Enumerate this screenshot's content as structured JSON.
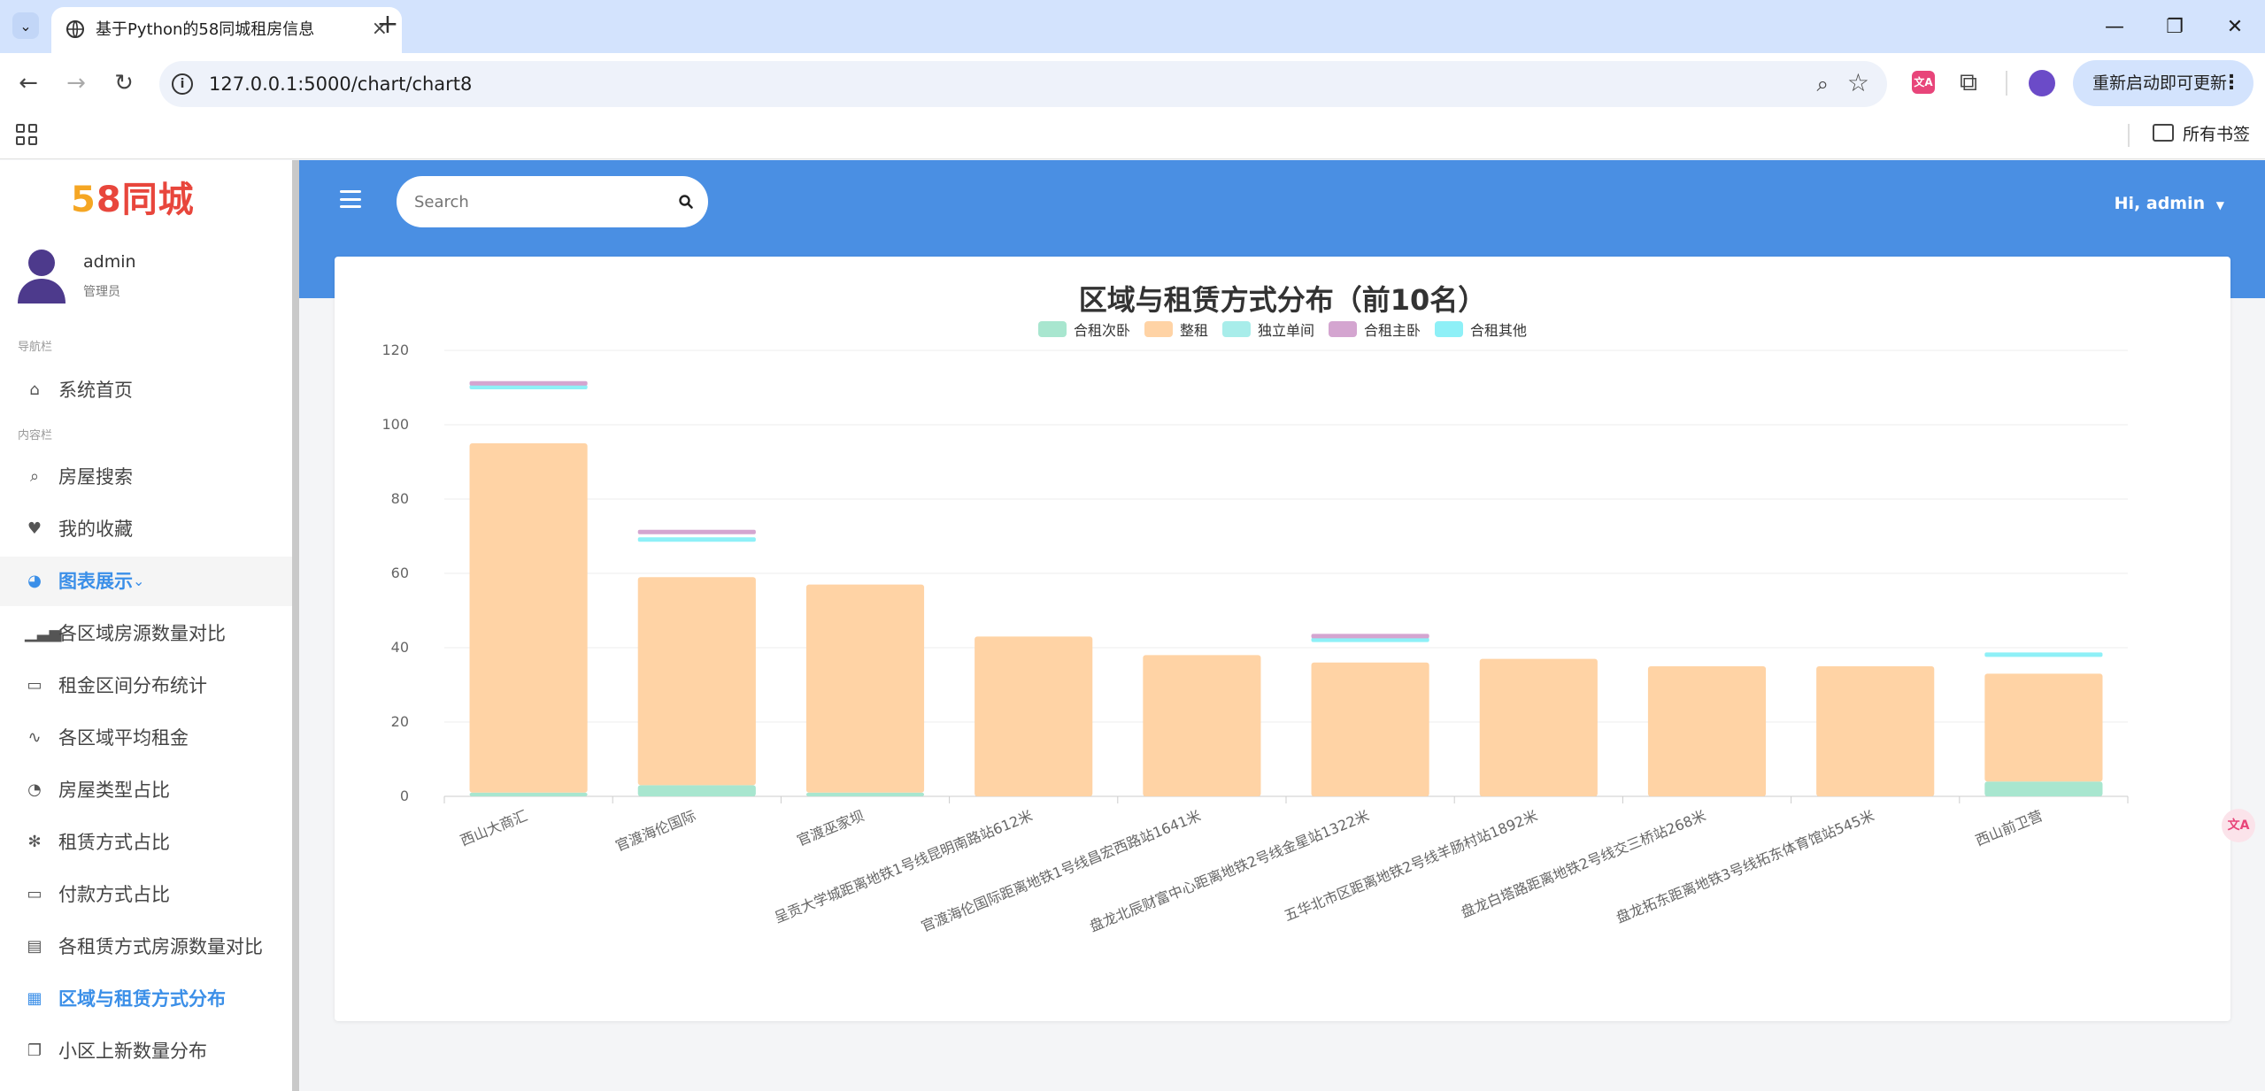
{
  "browser": {
    "tab_title": "基于Python的58同城租房信息",
    "url": "127.0.0.1:5000/chart/chart8",
    "update_button": "重新启动即可更新",
    "bookmarks_label": "所有书签"
  },
  "sidebar": {
    "logo_5": "5",
    "logo_8": "8",
    "logo_text": "同城",
    "user_name": "admin",
    "user_role": "管理员",
    "section_nav": "导航栏",
    "section_content": "内容栏",
    "items": [
      {
        "label": "系统首页",
        "icon": "home-icon"
      },
      {
        "label": "房屋搜索",
        "icon": "search-icon"
      },
      {
        "label": "我的收藏",
        "icon": "heart-icon"
      },
      {
        "label": "图表展示",
        "icon": "pie-chart-icon"
      },
      {
        "label": "各区域房源数量对比",
        "icon": "bar-signal-icon"
      },
      {
        "label": "租金区间分布统计",
        "icon": "keyboard-icon"
      },
      {
        "label": "各区域平均租金",
        "icon": "pulse-icon"
      },
      {
        "label": "房屋类型占比",
        "icon": "gauge-icon"
      },
      {
        "label": "租赁方式占比",
        "icon": "snowflake-icon"
      },
      {
        "label": "付款方式占比",
        "icon": "keyboard-icon"
      },
      {
        "label": "各租赁方式房源数量对比",
        "icon": "book-icon"
      },
      {
        "label": "区域与租赁方式分布",
        "icon": "calendar-icon"
      },
      {
        "label": "小区上新数量分布",
        "icon": "comments-icon"
      }
    ]
  },
  "header": {
    "search_placeholder": "Search",
    "greeting": "Hi, admin"
  },
  "colors": {
    "accent": "#4a8fe3",
    "active_menu": "#3b8fe8"
  },
  "chart_data": {
    "type": "bar",
    "stacked": true,
    "title": "区域与租赁方式分布（前10名）",
    "xlabel": "",
    "ylabel": "",
    "ylim": [
      0,
      120
    ],
    "yticks": [
      0,
      20,
      40,
      60,
      80,
      100,
      120
    ],
    "grid": true,
    "legend_position": "top-center",
    "categories": [
      "西山大商汇",
      "官渡海伦国际",
      "官渡巫家坝",
      "呈贡大学城距离地铁1号线昆明南路站612米",
      "官渡海伦国际距离地铁1号线昌宏西路站1641米",
      "盘龙北辰财富中心距离地铁2号线金星站1322米",
      "五华北市区距离地铁2号线羊肠村站1892米",
      "盘龙白塔路距离地铁2号线交三桥站268米",
      "盘龙拓东距离地铁3号线拓东体育馆站545米",
      "西山前卫营"
    ],
    "series": [
      {
        "name": "合租次卧",
        "color": "#a8e6cf",
        "values": [
          1,
          3,
          1,
          0,
          0,
          0,
          0,
          0,
          0,
          4
        ]
      },
      {
        "name": "整租",
        "color": "#ffd3a5",
        "values": [
          94,
          56,
          56,
          43,
          38,
          36,
          37,
          35,
          35,
          29
        ]
      },
      {
        "name": "独立单间",
        "color": "#a8edea",
        "values": [
          0,
          0,
          0,
          0,
          0,
          0,
          0,
          0,
          0,
          0
        ]
      },
      {
        "name": "合租主卧",
        "color": "#d4a5d0",
        "values": [
          0,
          0,
          0,
          0,
          0,
          0,
          0,
          0,
          0,
          0
        ]
      },
      {
        "name": "合租其他",
        "color": "#8ef0f7",
        "values": [
          0,
          0,
          0,
          0,
          0,
          0,
          0,
          0,
          0,
          0
        ]
      }
    ],
    "floating_segments": [
      {
        "category_index": 0,
        "series": "合租其他",
        "value": 110
      },
      {
        "category_index": 0,
        "series": "合租主卧",
        "value": 111
      },
      {
        "category_index": 1,
        "series": "合租其他",
        "value": 69
      },
      {
        "category_index": 1,
        "series": "合租主卧",
        "value": 71
      },
      {
        "category_index": 5,
        "series": "合租其他",
        "value": 42
      },
      {
        "category_index": 5,
        "series": "合租主卧",
        "value": 43
      },
      {
        "category_index": 9,
        "series": "合租其他",
        "value": 38
      }
    ]
  }
}
